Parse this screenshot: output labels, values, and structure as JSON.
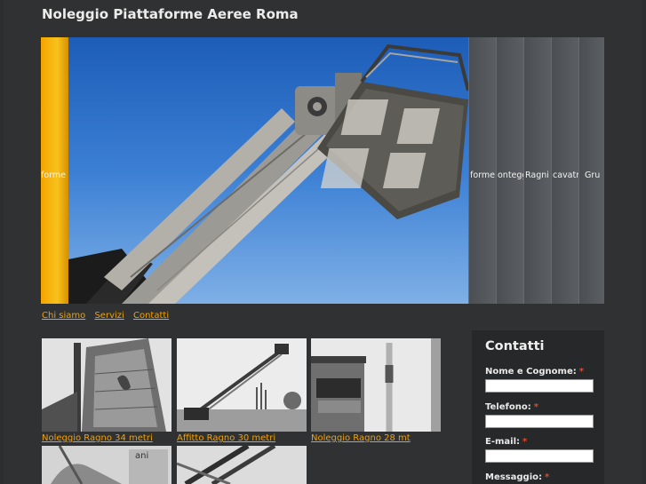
{
  "site": {
    "title": "Noleggio Piattaforme Aeree Roma"
  },
  "slider": {
    "active_label": "forme Mobili",
    "tabs": [
      {
        "label": "forme"
      },
      {
        "label": "ontegg"
      },
      {
        "label": "Ragni"
      },
      {
        "label": "cavatri"
      },
      {
        "label": "Gru"
      }
    ]
  },
  "nav": {
    "items": [
      {
        "label": "Chi siamo"
      },
      {
        "label": "Servizi"
      },
      {
        "label": "Contatti"
      }
    ]
  },
  "gallery": {
    "items": [
      {
        "caption": "Noleggio Ragno 34 metri"
      },
      {
        "caption": "Affitto Ragno 30 metri"
      },
      {
        "caption": "Noleggio Ragno 28 mt"
      },
      {
        "caption": ""
      },
      {
        "caption": ""
      }
    ],
    "sign_text": "ani"
  },
  "contact": {
    "title": "Contatti",
    "required_mark": "*",
    "fields": [
      {
        "label": "Nome e Cognome:",
        "value": ""
      },
      {
        "label": "Telefono:",
        "value": ""
      },
      {
        "label": "E-mail:",
        "value": ""
      },
      {
        "label": "Messaggio:",
        "value": ""
      }
    ]
  },
  "colors": {
    "accent": "#f5a000",
    "background": "#2f3133",
    "panel": "#262829",
    "required": "#e04a2a"
  }
}
